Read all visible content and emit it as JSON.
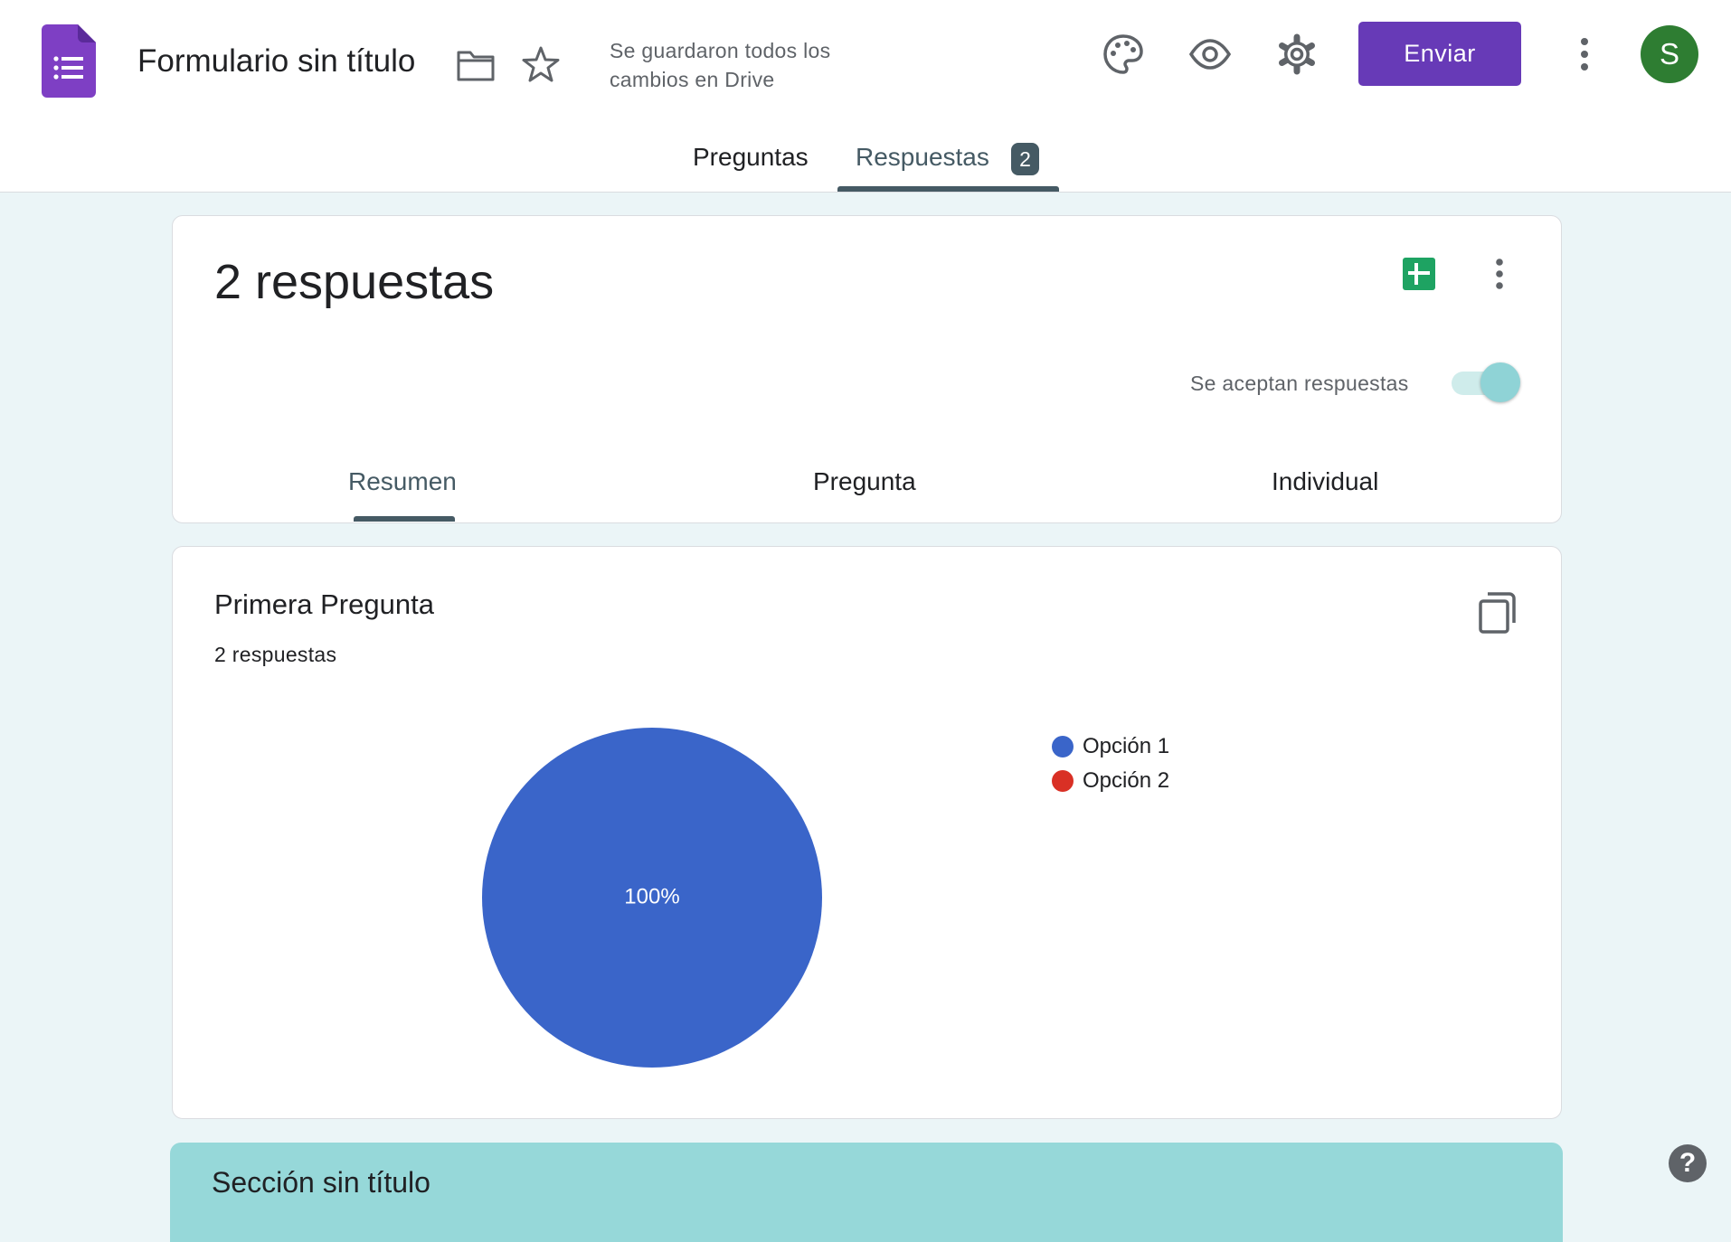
{
  "header": {
    "title": "Formulario sin título",
    "save_status": "Se guardaron todos los cambios en Drive",
    "send_label": "Enviar",
    "avatar_initial": "S",
    "icons": [
      "forms-logo-icon",
      "folder-icon",
      "star-icon",
      "palette-icon",
      "eye-icon",
      "gear-icon",
      "more-vert-icon"
    ],
    "brand_color": "#673ab7",
    "avatar_color": "#2e7d32"
  },
  "tabs": {
    "items": [
      {
        "label": "Preguntas",
        "active": false
      },
      {
        "label": "Respuestas",
        "active": true,
        "badge": "2"
      }
    ]
  },
  "summary": {
    "count_label": "2 respuestas",
    "accept_label": "Se aceptan respuestas",
    "accepting": true,
    "subtabs": [
      {
        "label": "Resumen",
        "active": true
      },
      {
        "label": "Pregunta",
        "active": false
      },
      {
        "label": "Individual",
        "active": false
      }
    ],
    "icons": [
      "sheets-icon",
      "more-vert-icon"
    ]
  },
  "question": {
    "title": "Primera Pregunta",
    "count_label": "2 respuestas",
    "icons": [
      "copy-icon"
    ]
  },
  "chart_data": {
    "type": "pie",
    "categories": [
      "Opción 1",
      "Opción 2"
    ],
    "values": [
      2,
      0
    ],
    "colors": [
      "#3a65c9",
      "#d93025"
    ],
    "slice_labels": [
      "100%",
      ""
    ],
    "legend": "right"
  },
  "section": {
    "title": "Sección sin título"
  },
  "help": {
    "label": "?"
  }
}
